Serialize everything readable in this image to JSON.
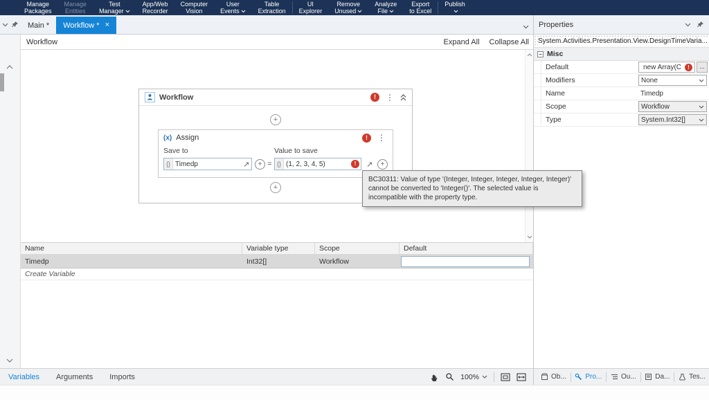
{
  "colors": {
    "accent": "#1584d6",
    "ribbon_bg": "#1c3357",
    "error": "#cf3a2b"
  },
  "icons": {
    "error": "!",
    "plus": "+",
    "equals": "=",
    "curly": "{}",
    "menu_dots": "⋮",
    "close": "×",
    "ellipsis": "...",
    "collapse_section": "−",
    "assign": "(x)"
  },
  "ribbon": {
    "items": [
      {
        "line1": "Manage",
        "line2": "Packages"
      },
      {
        "line1": "Manage",
        "line2": "Entities"
      },
      {
        "line1": "Test",
        "line2": "Manager"
      },
      {
        "line1": "App/Web",
        "line2": "Recorder"
      },
      {
        "line1": "Computer",
        "line2": "Vision"
      },
      {
        "line1": "User",
        "line2": "Events"
      },
      {
        "line1": "Table",
        "line2": "Extraction"
      },
      {
        "line1": "UI",
        "line2": "Explorer"
      },
      {
        "line1": "Remove",
        "line2": "Unused"
      },
      {
        "line1": "Analyze",
        "line2": "File"
      },
      {
        "line1": "Export",
        "line2": "to Excel"
      },
      {
        "line1": "Publish",
        "line2": ""
      }
    ]
  },
  "tabstrip": {
    "tabs": [
      {
        "label": "Main *"
      },
      {
        "label": "Workflow *"
      }
    ]
  },
  "designer": {
    "breadcrumb": "Workflow",
    "expand_all": "Expand All",
    "collapse_all": "Collapse All",
    "sequence": {
      "title": "Workflow"
    },
    "assign": {
      "title": "Assign",
      "save_to_label": "Save to",
      "value_to_save_label": "Value to save",
      "save_to_value": "Timedp",
      "value_to_save_value": "(1, 2, 3, 4, 5)"
    },
    "tooltip": "BC30311: Value of type '(Integer, Integer, Integer, Integer, Integer)' cannot be converted to 'Integer()'. The selected value is incompatible with the property type."
  },
  "variables": {
    "columns": [
      "Name",
      "Variable type",
      "Scope",
      "Default"
    ],
    "rows": [
      {
        "name": "Timedp",
        "variable_type": "Int32[]",
        "scope": "Workflow",
        "default": ""
      }
    ],
    "create_label": "Create Variable"
  },
  "statusbar": {
    "tabs": [
      {
        "label": "Variables"
      },
      {
        "label": "Arguments"
      },
      {
        "label": "Imports"
      }
    ],
    "zoom": "100%"
  },
  "properties": {
    "title": "Properties",
    "type_path": "System.Activities.Presentation.View.DesignTimeVaria...",
    "section": "Misc",
    "rows": [
      {
        "label": "Default",
        "value": "new Array(C"
      },
      {
        "label": "Modifiers",
        "value": "None"
      },
      {
        "label": "Name",
        "value": "Timedp"
      },
      {
        "label": "Scope",
        "value": "Workflow"
      },
      {
        "label": "Type",
        "value": "System.Int32[]"
      }
    ]
  },
  "panel_tabs": {
    "items": [
      {
        "label": "Ob..."
      },
      {
        "label": "Pro..."
      },
      {
        "label": "Ou..."
      },
      {
        "label": "Da..."
      },
      {
        "label": "Tes..."
      }
    ]
  }
}
